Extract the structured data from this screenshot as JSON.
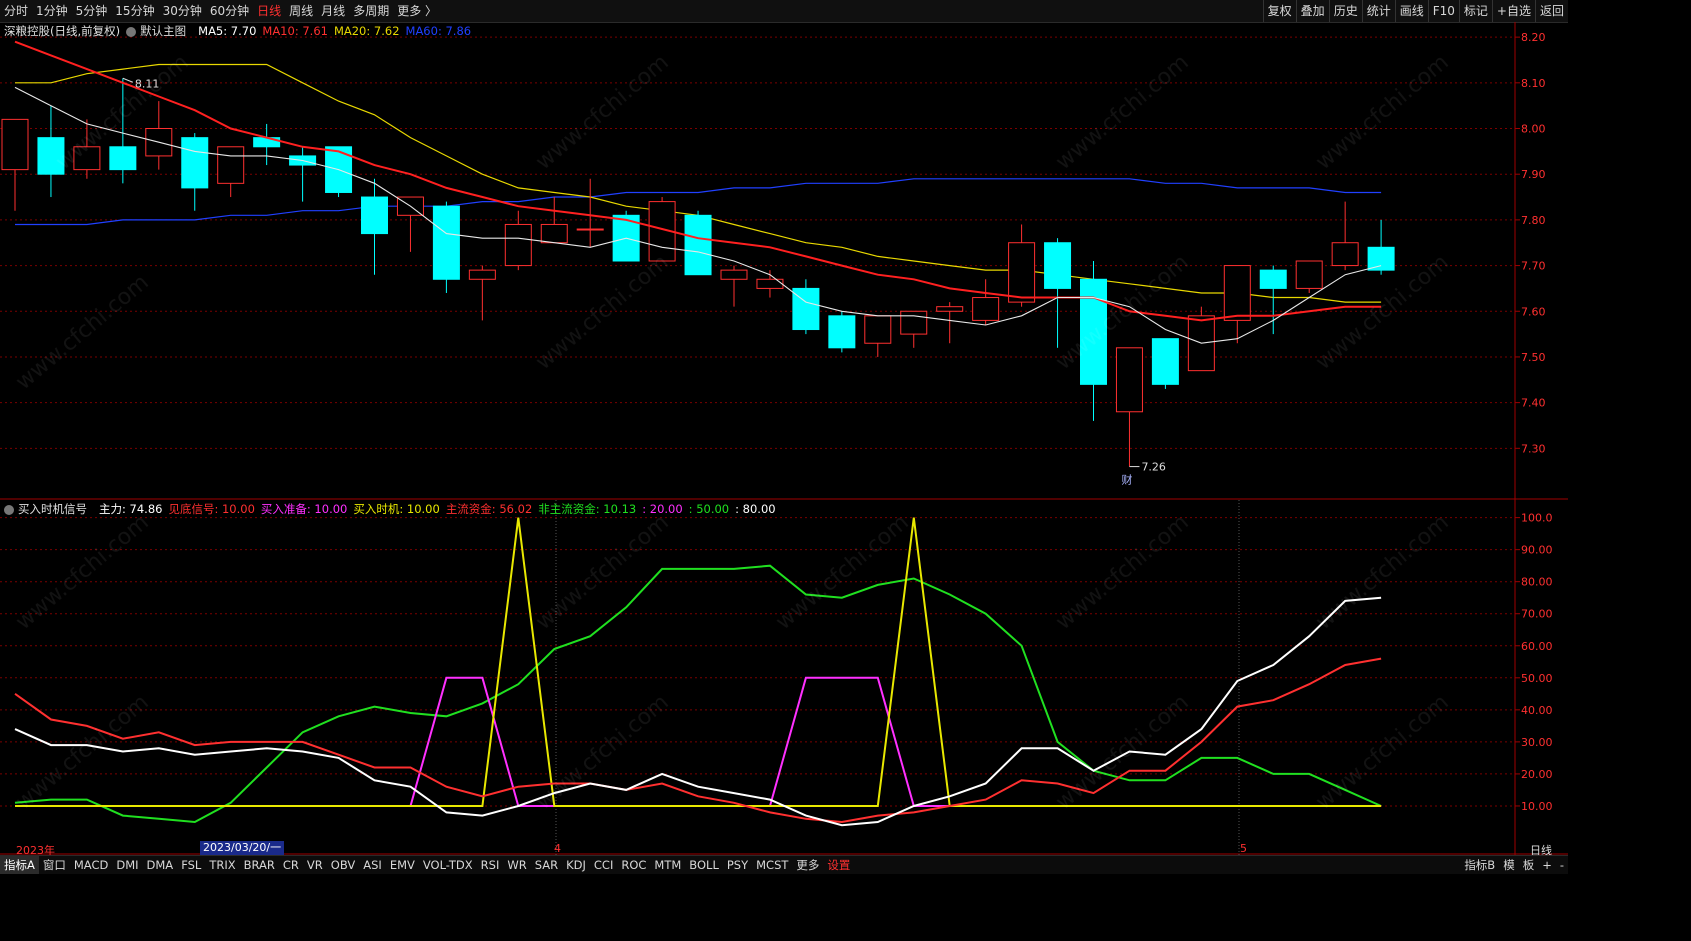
{
  "toolbar": {
    "periods": [
      "分时",
      "1分钟",
      "5分钟",
      "15分钟",
      "30分钟",
      "60分钟",
      "日线",
      "周线",
      "月线",
      "多周期",
      "更多 〉"
    ],
    "active_period": "日线",
    "right_items": [
      "复权",
      "叠加",
      "历史",
      "统计",
      "画线",
      "F10",
      "标记",
      "+自选",
      "返回"
    ]
  },
  "main": {
    "stock": "深粮控股(日线,前复权)",
    "main_label": "默认主图",
    "ma5": {
      "label": "MA5: 7.70",
      "color": "#ffffff"
    },
    "ma10": {
      "label": "MA10: 7.61",
      "color": "#ff3030"
    },
    "ma20": {
      "label": "MA20: 7.62",
      "color": "#e8d800"
    },
    "ma60": {
      "label": "MA60: 7.86",
      "color": "#2040ff"
    },
    "y_ticks": [
      "8.20",
      "8.10",
      "8.00",
      "7.90",
      "7.80",
      "7.70",
      "7.60",
      "7.50",
      "7.40",
      "7.30"
    ],
    "high_note": "8.11",
    "low_note": "7.26",
    "fin_badge": "财"
  },
  "sub": {
    "indicator": "买入时机信号",
    "items": [
      {
        "label": "主力: 74.86",
        "color": "#ffffff"
      },
      {
        "label": "见底信号: 10.00",
        "color": "#ff3030"
      },
      {
        "label": "买入准备: 10.00",
        "color": "#ff30ff"
      },
      {
        "label": "买入时机: 10.00",
        "color": "#e8e800"
      },
      {
        "label": "主流资金: 56.02",
        "color": "#ff3030"
      },
      {
        "label": "非主流资金: 10.13",
        "color": "#20e020"
      },
      {
        "label": ": 20.00",
        "color": "#ff30ff"
      },
      {
        "label": ": 50.00",
        "color": "#20e020"
      },
      {
        "label": ": 80.00",
        "color": "#ffffff"
      }
    ],
    "y_ticks": [
      "100.0",
      "90.00",
      "80.00",
      "70.00",
      "60.00",
      "50.00",
      "40.00",
      "30.00",
      "20.00",
      "10.00"
    ]
  },
  "xaxis": {
    "labels": [
      "2023年",
      "4",
      "5"
    ],
    "cursor_date": "2023/03/20/一",
    "period_label": "日线"
  },
  "bottom": {
    "tabs": [
      "指标A",
      "窗口",
      "MACD",
      "DMI",
      "DMA",
      "FSL",
      "TRIX",
      "BRAR",
      "CR",
      "VR",
      "OBV",
      "ASI",
      "EMV",
      "VOL-TDX",
      "RSI",
      "WR",
      "SAR",
      "KDJ",
      "CCI",
      "ROC",
      "MTM",
      "BOLL",
      "PSY",
      "MCST",
      "更多",
      "设置"
    ],
    "right": [
      "指标B",
      "模",
      "板",
      "+",
      "-"
    ]
  },
  "watermark": "www.cfchi.com",
  "chart_data": [
    {
      "type": "candlestick",
      "title": "深粮控股(日线,前复权)",
      "ylim": [
        7.2,
        8.22
      ],
      "candles": [
        {
          "o": 7.91,
          "h": 7.98,
          "l": 7.82,
          "c": 8.02
        },
        {
          "o": 7.98,
          "h": 8.05,
          "l": 7.85,
          "c": 7.9
        },
        {
          "o": 7.91,
          "h": 8.02,
          "l": 7.89,
          "c": 7.96
        },
        {
          "o": 7.96,
          "h": 8.11,
          "l": 7.88,
          "c": 7.91
        },
        {
          "o": 7.94,
          "h": 8.06,
          "l": 7.91,
          "c": 8.0
        },
        {
          "o": 7.98,
          "h": 7.99,
          "l": 7.82,
          "c": 7.87
        },
        {
          "o": 7.88,
          "h": 7.96,
          "l": 7.85,
          "c": 7.96
        },
        {
          "o": 7.98,
          "h": 8.01,
          "l": 7.92,
          "c": 7.96
        },
        {
          "o": 7.94,
          "h": 7.96,
          "l": 7.84,
          "c": 7.92
        },
        {
          "o": 7.96,
          "h": 7.96,
          "l": 7.85,
          "c": 7.86
        },
        {
          "o": 7.85,
          "h": 7.89,
          "l": 7.68,
          "c": 7.77
        },
        {
          "o": 7.81,
          "h": 7.85,
          "l": 7.73,
          "c": 7.85
        },
        {
          "o": 7.83,
          "h": 7.84,
          "l": 7.64,
          "c": 7.67
        },
        {
          "o": 7.67,
          "h": 7.7,
          "l": 7.58,
          "c": 7.69
        },
        {
          "o": 7.7,
          "h": 7.82,
          "l": 7.69,
          "c": 7.79
        },
        {
          "o": 7.75,
          "h": 7.85,
          "l": 7.75,
          "c": 7.79
        },
        {
          "o": 7.78,
          "h": 7.89,
          "l": 7.74,
          "c": 7.78
        },
        {
          "o": 7.81,
          "h": 7.82,
          "l": 7.71,
          "c": 7.71
        },
        {
          "o": 7.71,
          "h": 7.85,
          "l": 7.71,
          "c": 7.84
        },
        {
          "o": 7.81,
          "h": 7.82,
          "l": 7.68,
          "c": 7.68
        },
        {
          "o": 7.67,
          "h": 7.7,
          "l": 7.61,
          "c": 7.69
        },
        {
          "o": 7.65,
          "h": 7.69,
          "l": 7.63,
          "c": 7.67
        },
        {
          "o": 7.65,
          "h": 7.67,
          "l": 7.55,
          "c": 7.56
        },
        {
          "o": 7.59,
          "h": 7.6,
          "l": 7.51,
          "c": 7.52
        },
        {
          "o": 7.53,
          "h": 7.59,
          "l": 7.5,
          "c": 7.59
        },
        {
          "o": 7.55,
          "h": 7.6,
          "l": 7.52,
          "c": 7.6
        },
        {
          "o": 7.6,
          "h": 7.62,
          "l": 7.53,
          "c": 7.61
        },
        {
          "o": 7.58,
          "h": 7.67,
          "l": 7.57,
          "c": 7.63
        },
        {
          "o": 7.62,
          "h": 7.79,
          "l": 7.61,
          "c": 7.75
        },
        {
          "o": 7.75,
          "h": 7.76,
          "l": 7.52,
          "c": 7.65
        },
        {
          "o": 7.67,
          "h": 7.71,
          "l": 7.36,
          "c": 7.44
        },
        {
          "o": 7.38,
          "h": 7.52,
          "l": 7.26,
          "c": 7.52
        },
        {
          "o": 7.54,
          "h": 7.54,
          "l": 7.43,
          "c": 7.44
        },
        {
          "o": 7.47,
          "h": 7.61,
          "l": 7.47,
          "c": 7.59
        },
        {
          "o": 7.58,
          "h": 7.7,
          "l": 7.53,
          "c": 7.7
        },
        {
          "o": 7.69,
          "h": 7.7,
          "l": 7.55,
          "c": 7.65
        },
        {
          "o": 7.65,
          "h": 7.71,
          "l": 7.64,
          "c": 7.71
        },
        {
          "o": 7.7,
          "h": 7.84,
          "l": 7.69,
          "c": 7.75
        },
        {
          "o": 7.74,
          "h": 7.8,
          "l": 7.68,
          "c": 7.69
        }
      ],
      "ma5": [
        8.09,
        8.05,
        8.01,
        7.99,
        7.97,
        7.95,
        7.94,
        7.94,
        7.93,
        7.91,
        7.88,
        7.83,
        7.77,
        7.76,
        7.76,
        7.75,
        7.74,
        7.76,
        7.74,
        7.73,
        7.71,
        7.68,
        7.62,
        7.6,
        7.59,
        7.59,
        7.58,
        7.57,
        7.59,
        7.63,
        7.63,
        7.61,
        7.56,
        7.53,
        7.54,
        7.58,
        7.63,
        7.68,
        7.7
      ],
      "ma10": [
        8.19,
        8.16,
        8.13,
        8.1,
        8.07,
        8.04,
        8.0,
        7.98,
        7.96,
        7.95,
        7.92,
        7.9,
        7.87,
        7.85,
        7.83,
        7.82,
        7.81,
        7.8,
        7.78,
        7.76,
        7.75,
        7.74,
        7.72,
        7.7,
        7.68,
        7.67,
        7.65,
        7.64,
        7.63,
        7.63,
        7.63,
        7.6,
        7.59,
        7.58,
        7.59,
        7.59,
        7.6,
        7.61,
        7.61
      ],
      "ma20": [
        8.1,
        8.1,
        8.12,
        8.13,
        8.14,
        8.14,
        8.14,
        8.14,
        8.1,
        8.06,
        8.03,
        7.98,
        7.94,
        7.9,
        7.87,
        7.86,
        7.85,
        7.83,
        7.82,
        7.81,
        7.79,
        7.77,
        7.75,
        7.74,
        7.72,
        7.71,
        7.7,
        7.69,
        7.69,
        7.68,
        7.67,
        7.66,
        7.65,
        7.64,
        7.64,
        7.63,
        7.63,
        7.62,
        7.62
      ],
      "ma60": [
        7.79,
        7.79,
        7.79,
        7.8,
        7.8,
        7.8,
        7.81,
        7.81,
        7.82,
        7.82,
        7.83,
        7.83,
        7.83,
        7.84,
        7.84,
        7.85,
        7.85,
        7.86,
        7.86,
        7.86,
        7.87,
        7.87,
        7.88,
        7.88,
        7.88,
        7.89,
        7.89,
        7.89,
        7.89,
        7.89,
        7.89,
        7.89,
        7.88,
        7.88,
        7.87,
        7.87,
        7.87,
        7.86,
        7.86
      ]
    },
    {
      "type": "line",
      "title": "买入时机信号",
      "ylim": [
        0,
        103
      ],
      "series": [
        {
          "name": "主力",
          "color": "#ffffff",
          "values": [
            34,
            29,
            29,
            27,
            28,
            26,
            27,
            28,
            27,
            25,
            18,
            16,
            8,
            7,
            10,
            14,
            17,
            15,
            20,
            16,
            14,
            12,
            7,
            4,
            5,
            10,
            13,
            17,
            28,
            28,
            21,
            27,
            26,
            34,
            49,
            54,
            63,
            74,
            75
          ]
        },
        {
          "name": "主流资金",
          "color": "#ff3030",
          "values": [
            45,
            37,
            35,
            31,
            33,
            29,
            30,
            30,
            30,
            26,
            22,
            22,
            16,
            13,
            16,
            17,
            17,
            15,
            17,
            13,
            11,
            8,
            6,
            5,
            7,
            8,
            10,
            12,
            18,
            17,
            14,
            21,
            21,
            30,
            41,
            43,
            48,
            54,
            56
          ]
        },
        {
          "name": "非主流资金",
          "color": "#20e020",
          "values": [
            11,
            12,
            12,
            7,
            6,
            5,
            11,
            22,
            33,
            38,
            41,
            39,
            38,
            42,
            48,
            59,
            63,
            72,
            84,
            84,
            84,
            85,
            76,
            75,
            79,
            81,
            76,
            70,
            60,
            30,
            21,
            18,
            18,
            25,
            25,
            20,
            20,
            15,
            10
          ]
        },
        {
          "name": "买入准备",
          "color": "#ff30ff",
          "values": [
            10,
            10,
            10,
            10,
            10,
            10,
            10,
            10,
            10,
            10,
            10,
            10,
            50,
            50,
            10,
            10,
            10,
            10,
            10,
            10,
            10,
            10,
            50,
            50,
            50,
            10,
            10,
            10,
            10,
            10,
            10,
            10,
            10,
            10,
            10,
            10,
            10,
            10,
            10
          ]
        },
        {
          "name": "买入时机",
          "color": "#e8e800",
          "values": [
            10,
            10,
            10,
            10,
            10,
            10,
            10,
            10,
            10,
            10,
            10,
            10,
            10,
            10,
            100,
            10,
            10,
            10,
            10,
            10,
            10,
            10,
            10,
            10,
            10,
            100,
            10,
            10,
            10,
            10,
            10,
            10,
            10,
            10,
            10,
            10,
            10,
            10,
            10
          ]
        }
      ]
    }
  ]
}
